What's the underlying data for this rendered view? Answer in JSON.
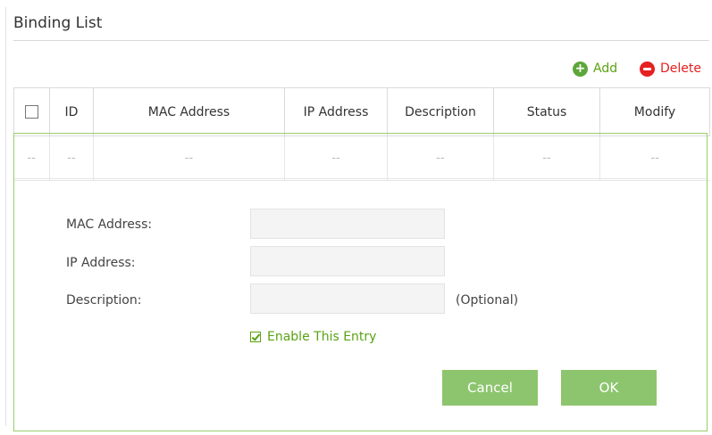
{
  "title": "Binding List",
  "toolbar": {
    "add_label": "Add",
    "delete_label": "Delete"
  },
  "table": {
    "headers": [
      "ID",
      "MAC Address",
      "IP Address",
      "Description",
      "Status",
      "Modify"
    ],
    "placeholder_row": [
      "--",
      "--",
      "--",
      "--",
      "--",
      "--",
      "--"
    ]
  },
  "form": {
    "mac_label": "MAC Address:",
    "ip_label": "IP Address:",
    "description_label": "Description:",
    "mac_value": "",
    "ip_value": "",
    "description_value": "",
    "optional_hint": "(Optional)",
    "enable_label": "Enable This Entry",
    "enable_checked": true,
    "cancel_label": "Cancel",
    "ok_label": "OK"
  },
  "colors": {
    "accent_green": "#59a312",
    "button_green": "#8dc56e",
    "delete_red": "#e62020"
  }
}
